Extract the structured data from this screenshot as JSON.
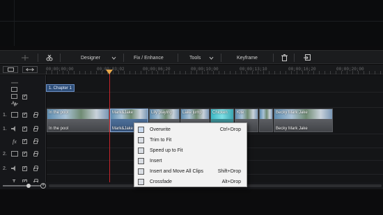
{
  "toolbar": {
    "designer": "Designer",
    "fix_enhance": "Fix / Enhance",
    "tools": "Tools",
    "keyframe": "Keyframe"
  },
  "ruler": {
    "ticks": [
      "00;00;00;00",
      "00;00;03;02",
      "00;00;06;20",
      "00;00;10;00",
      "00;00;13;10",
      "00;00;16;20",
      "00;00;20;00"
    ]
  },
  "chapter": {
    "label": "1. Chapter 1"
  },
  "tracks": [
    {
      "label": "1."
    },
    {
      "label": "1."
    },
    {
      "label": "fx"
    },
    {
      "label": "2."
    },
    {
      "label": "2."
    },
    {
      "label": "T"
    }
  ],
  "clips": [
    {
      "title": "In the pool"
    },
    {
      "title": "Mark&Jake"
    },
    {
      "title": "Lily playing"
    },
    {
      "title": "Lake jump"
    },
    {
      "title": "Chicken"
    },
    {
      "title": "Kite"
    },
    {
      "title": "Becky Mark Jake"
    }
  ],
  "context_menu": {
    "items": [
      {
        "label": "Overwrite",
        "shortcut": "Ctrl+Drop"
      },
      {
        "label": "Trim to Fit",
        "shortcut": ""
      },
      {
        "label": "Speed up to Fit",
        "shortcut": ""
      },
      {
        "label": "Insert",
        "shortcut": ""
      },
      {
        "label": "Insert and Move All Clips",
        "shortcut": "Shift+Drop"
      },
      {
        "label": "Crossfade",
        "shortcut": "Alt+Drop"
      }
    ]
  }
}
